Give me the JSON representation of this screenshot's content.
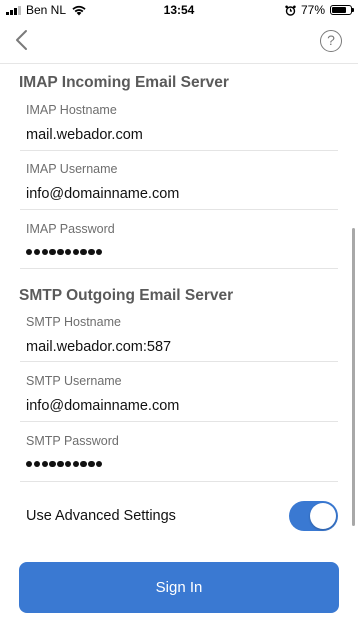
{
  "status_bar": {
    "carrier": "Ben NL",
    "time": "13:54",
    "battery": "77%",
    "battery_level": 0.77
  },
  "nav": {
    "back_icon": "chevron-left-icon",
    "help_label": "?"
  },
  "imap": {
    "title": "IMAP Incoming Email Server",
    "hostname_label": "IMAP Hostname",
    "hostname_value": "mail.webador.com",
    "username_label": "IMAP Username",
    "username_value": "info@domainname.com",
    "password_label": "IMAP Password",
    "password_mask_length": 10
  },
  "smtp": {
    "title": "SMTP Outgoing Email Server",
    "hostname_label": "SMTP Hostname",
    "hostname_value": "mail.webador.com:587",
    "username_label": "SMTP Username",
    "username_value": "info@domainname.com",
    "password_label": "SMTP Password",
    "password_mask_length": 10
  },
  "advanced": {
    "label": "Use Advanced Settings",
    "enabled": true
  },
  "actions": {
    "sign_in_label": "Sign In"
  },
  "colors": {
    "accent": "#3a79d2",
    "section_title": "#5a5a5a",
    "field_label": "#6e6e6e"
  }
}
